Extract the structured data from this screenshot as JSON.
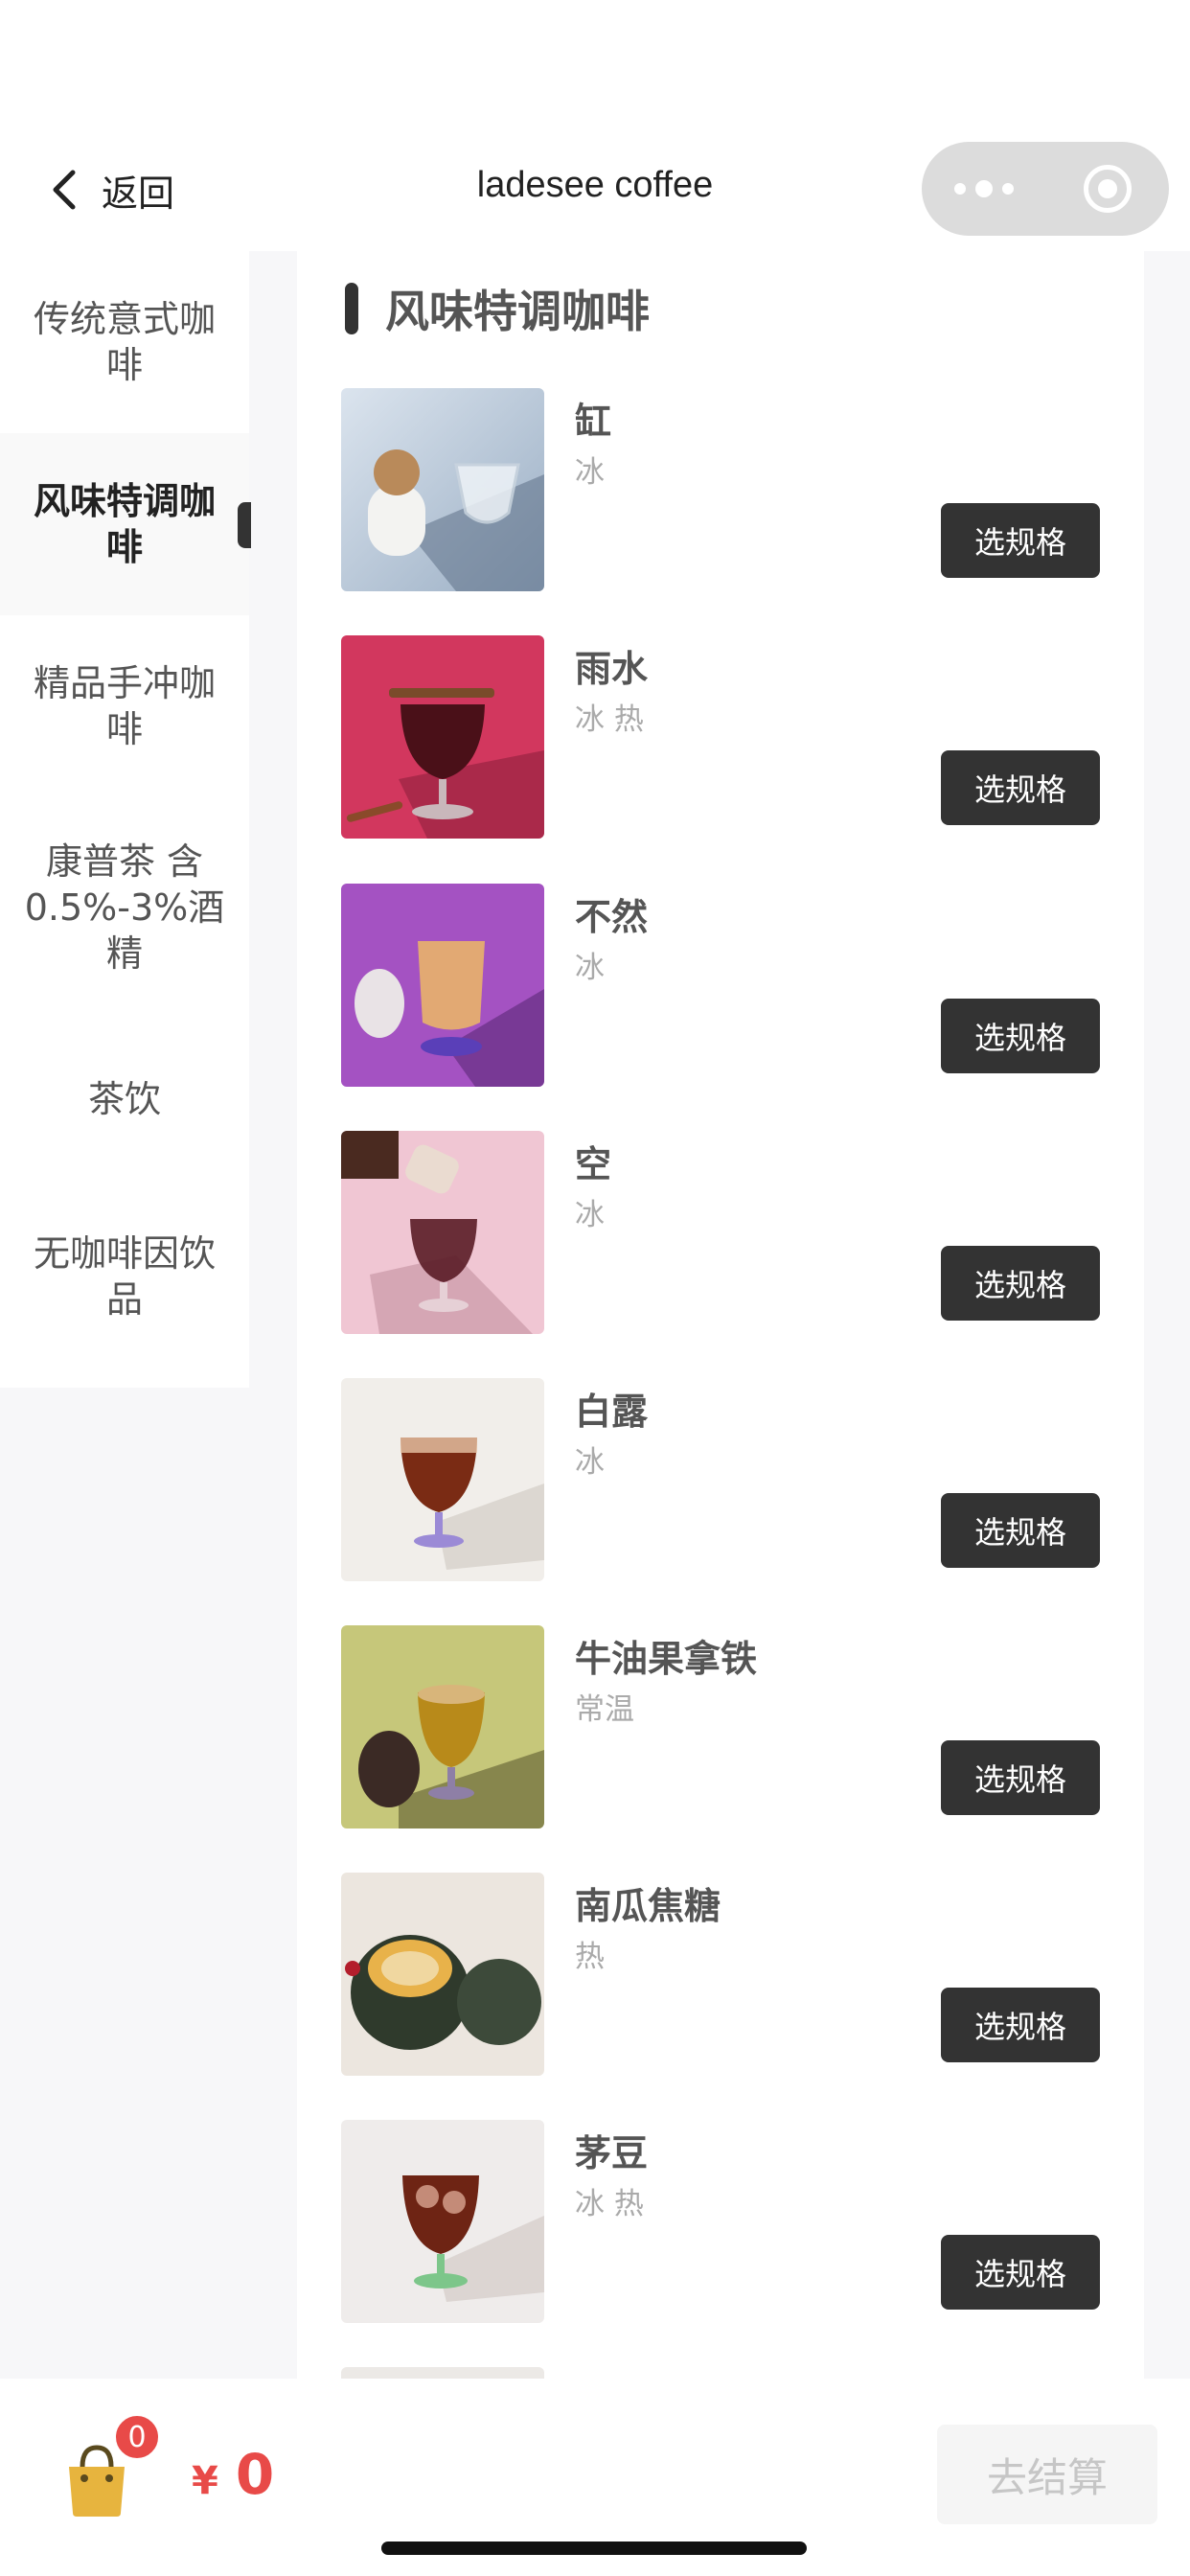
{
  "nav": {
    "back_label": "返回",
    "title": "ladesee coffee"
  },
  "sidebar": {
    "items": [
      {
        "label": "传统意式咖啡"
      },
      {
        "label": "风味特调咖啡"
      },
      {
        "label": "精品手冲咖啡"
      },
      {
        "label": "康普茶 含0.5%-3%酒精"
      },
      {
        "label": "茶饮"
      },
      {
        "label": "无咖啡因饮品"
      }
    ],
    "active_index": 1
  },
  "section": {
    "title": "风味特调咖啡"
  },
  "products": [
    {
      "name": "缸",
      "temp": "冰",
      "button": "选规格"
    },
    {
      "name": "雨水",
      "temp": "冰 热",
      "button": "选规格"
    },
    {
      "name": "不然",
      "temp": "冰",
      "button": "选规格"
    },
    {
      "name": "空",
      "temp": "冰",
      "button": "选规格"
    },
    {
      "name": "白露",
      "temp": "冰",
      "button": "选规格"
    },
    {
      "name": "牛油果拿铁",
      "temp": "常温",
      "button": "选规格"
    },
    {
      "name": "南瓜焦糖",
      "temp": "热",
      "button": "选规格"
    },
    {
      "name": "茅豆",
      "temp": "冰 热",
      "button": "选规格"
    }
  ],
  "cart": {
    "count": "0",
    "currency": "¥",
    "amount": "0",
    "checkout_label": "去结算"
  },
  "colors": {
    "accent": "#333333",
    "price": "#e84a48",
    "background": "#f7f7f9"
  },
  "icons": [
    "chevron-left-icon",
    "more-icon",
    "close-icon",
    "shopping-bag-icon"
  ]
}
